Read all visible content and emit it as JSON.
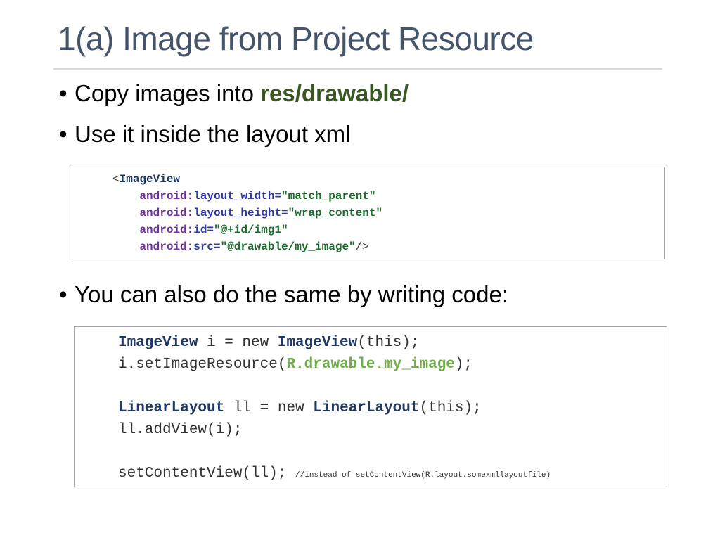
{
  "slide": {
    "title": "1(a) Image from Project Resource",
    "bullets": {
      "b1_text": "Copy images into ",
      "b1_highlight": "res/drawable/",
      "b2_text": "Use it inside the layout xml",
      "b3_text": "You can also do the same by writing code:"
    },
    "bullet_symbol": "•"
  },
  "xml_code": {
    "open_bracket": "<",
    "tag": "ImageView",
    "ns": "android:",
    "attr1_name": "layout_width=",
    "attr1_value": "\"match_parent\"",
    "attr2_name": "layout_height=",
    "attr2_value": "\"wrap_content\"",
    "attr3_name": "id=",
    "attr3_value": "\"@+id/img1\"",
    "attr4_name": "src=",
    "attr4_value": "\"@drawable/my_image\"",
    "close": "/>"
  },
  "java_code": {
    "l1_type": "ImageView",
    "l1_mid": " i = new ",
    "l1_type2": "ImageView",
    "l1_end": "(this);",
    "l2_start": "i.setImageResource(",
    "l2_res": "R.drawable.my_image",
    "l2_end": ");",
    "l3_type": "LinearLayout",
    "l3_mid": " ll = new ",
    "l3_type2": "LinearLayout",
    "l3_end": "(this);",
    "l4": "ll.addView(i);",
    "l5": "setContentView(ll); ",
    "l5_comment": "//instead of setContentView(R.layout.somexmllayoutfile)"
  },
  "colors": {
    "title": "#44546a",
    "highlight": "#385723",
    "code_type": "#1f3864",
    "code_resource": "#70ad47",
    "xml_namespace": "#7030a0"
  }
}
